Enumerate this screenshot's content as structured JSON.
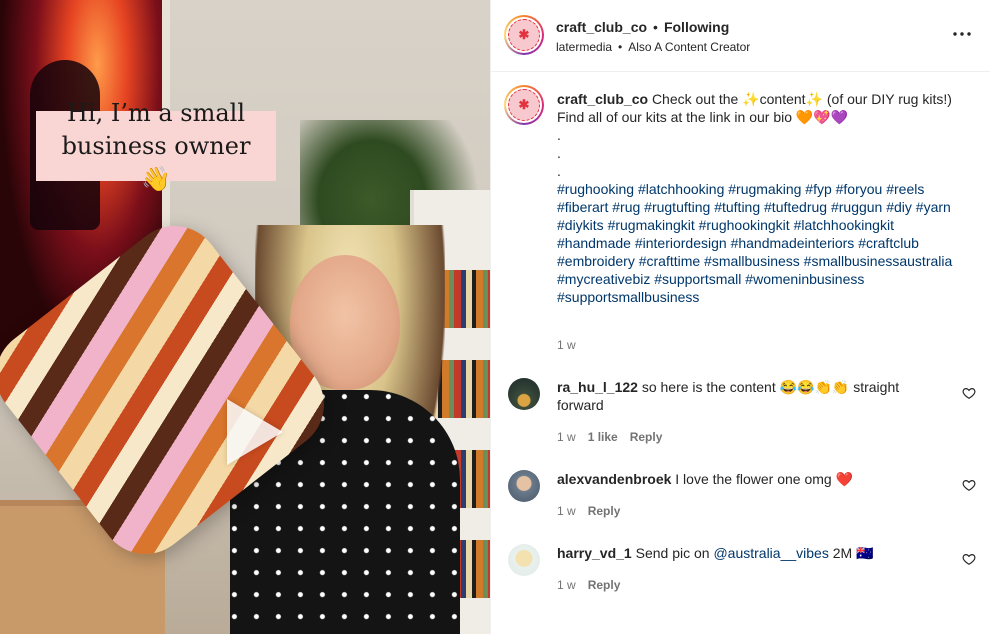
{
  "media": {
    "overlay_caption_line1": "Hi, I’m a small",
    "overlay_caption_line2": "business owner 👋"
  },
  "header": {
    "username": "craft_club_co",
    "separator": "•",
    "follow_status": "Following",
    "subline_user": "latermedia",
    "subline_sep": "•",
    "subline_text": "Also A Content Creator",
    "more_icon": "…"
  },
  "post": {
    "username": "craft_club_co",
    "caption_part1": "Check out the ✨content✨ (of our DIY rug kits!)",
    "caption_line2": "Find all of our kits at the link in our bio 🧡💖💜",
    "dot1": ".",
    "dot2": ".",
    "dot3": ".",
    "hashtags": "#rughooking #latchhooking #rugmaking #fyp #foryou #reels #fiberart #rug #rugtufting #tufting #tuftedrug #ruggun #diy #yarn #diykits #rugmakingkit #rughookingkit #latchhookingkit #handmade #interiordesign #handmadeinteriors #craftclub #embroidery #crafttime #smallbusiness #smallbusinessaustralia #mycreativebiz #supportsmall #womeninbusiness #supportsmallbusiness",
    "time": "1 w"
  },
  "comments": [
    {
      "username": "ra_hu_l_122",
      "text": "so here is the content 😂😂👏👏 straight forward",
      "time": "1 w",
      "likes": "1 like",
      "reply": "Reply"
    },
    {
      "username": "alexvandenbroek",
      "text": "I love the flower one omg ❤️",
      "time": "1 w",
      "reply": "Reply"
    },
    {
      "username": "harry_vd_1",
      "text_before": "Send pic on",
      "mention": "@australia__vibes",
      "text_after": "2M 🇦🇺",
      "time": "1 w",
      "reply": "Reply"
    }
  ],
  "colors": {
    "link": "#00376b",
    "muted": "#737373",
    "caption_bg": "#f9d6d3"
  }
}
